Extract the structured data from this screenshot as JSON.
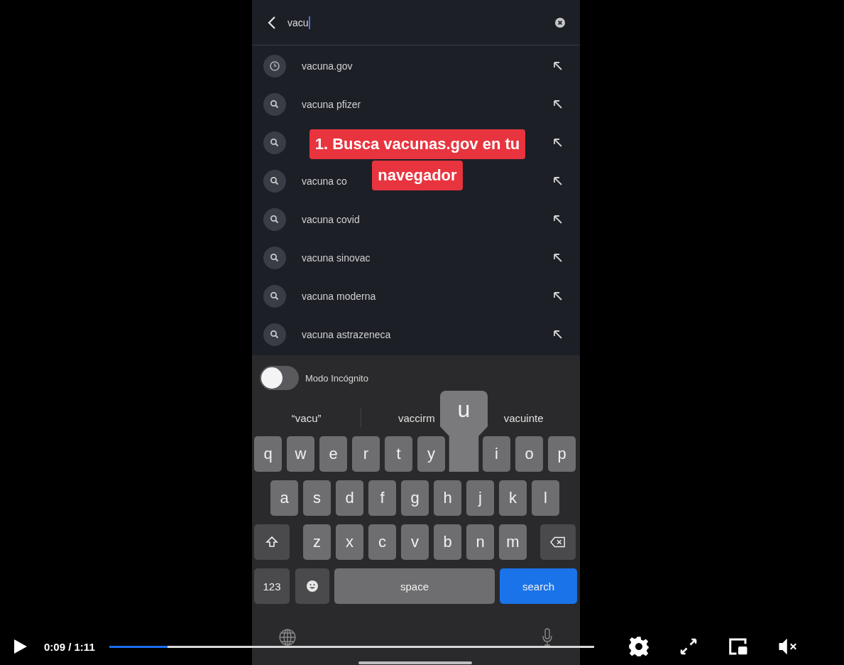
{
  "search_bar": {
    "value": "vacu"
  },
  "suggestions": [
    {
      "kind": "history",
      "text": "vacuna.gov"
    },
    {
      "kind": "search",
      "text": "vacuna pfizer"
    },
    {
      "kind": "search"
    },
    {
      "kind": "search",
      "text": "vacuna co"
    },
    {
      "kind": "search",
      "text": "vacuna covid"
    },
    {
      "kind": "search",
      "text": "vacuna sinovac"
    },
    {
      "kind": "search",
      "text": "vacuna moderna"
    },
    {
      "kind": "search",
      "text": "vacuna astrazeneca"
    }
  ],
  "caption": [
    "1. Busca vacunas.gov en tu",
    "navegador"
  ],
  "incognito": {
    "label": "Modo Incógnito",
    "on": false
  },
  "word_suggestions": [
    "“vacu”",
    "vaccirm",
    "vacuinte"
  ],
  "keyboard": [
    [
      {
        "kind": "letter",
        "label": "q"
      },
      {
        "kind": "letter",
        "label": "w"
      },
      {
        "kind": "letter",
        "label": "e"
      },
      {
        "kind": "letter",
        "label": "r"
      },
      {
        "kind": "letter",
        "label": "t"
      },
      {
        "kind": "letter",
        "label": "y"
      },
      {
        "kind": "letter",
        "label": "u",
        "pressed": true
      },
      {
        "kind": "letter",
        "label": "i"
      },
      {
        "kind": "letter",
        "label": "o"
      },
      {
        "kind": "letter",
        "label": "p"
      }
    ],
    [
      {
        "kind": "letter",
        "label": "a"
      },
      {
        "kind": "letter",
        "label": "s"
      },
      {
        "kind": "letter",
        "label": "d"
      },
      {
        "kind": "letter",
        "label": "f"
      },
      {
        "kind": "letter",
        "label": "g"
      },
      {
        "kind": "letter",
        "label": "h"
      },
      {
        "kind": "letter",
        "label": "j"
      },
      {
        "kind": "letter",
        "label": "k"
      },
      {
        "kind": "letter",
        "label": "l"
      }
    ],
    [
      {
        "kind": "shift"
      },
      {
        "kind": "letter",
        "label": "z"
      },
      {
        "kind": "letter",
        "label": "x"
      },
      {
        "kind": "letter",
        "label": "c"
      },
      {
        "kind": "letter",
        "label": "v"
      },
      {
        "kind": "letter",
        "label": "b"
      },
      {
        "kind": "letter",
        "label": "n"
      },
      {
        "kind": "letter",
        "label": "m"
      },
      {
        "kind": "delete"
      }
    ],
    [
      {
        "kind": "numbers",
        "label": "123"
      },
      {
        "kind": "emoji"
      },
      {
        "kind": "space",
        "label": "space"
      },
      {
        "kind": "search",
        "label": "search"
      }
    ]
  ],
  "player": {
    "time": "0:09 / 1:11",
    "level": 0.12
  }
}
